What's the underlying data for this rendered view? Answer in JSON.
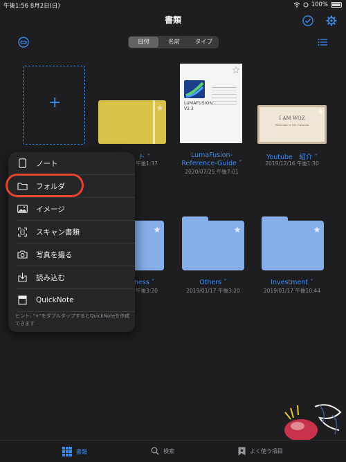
{
  "status": {
    "time": "午後1:56",
    "date": "8月2日(日)",
    "battery": "100%"
  },
  "header": {
    "title": "書類"
  },
  "sort": {
    "options": [
      "日付",
      "名前",
      "タイプ"
    ],
    "selected": "日付"
  },
  "documents": [
    {
      "label": "ノート",
      "date": "午後1:37"
    },
    {
      "label": "LumaFusion-Reference-Guide",
      "label_line1": "LumaFusion-",
      "label_line2": "Reference-Guide",
      "date": "2020/07/25 午後7:01",
      "cover_text_1": "LUMAFUSION",
      "cover_text_2": "V2.3"
    },
    {
      "label": "Youtube　紹介",
      "date": "2019/12/16 午後1:30",
      "cover_text_1": "I AM WOZ",
      "cover_text_2": "Welcome to Mr Caravan"
    }
  ],
  "folders": [
    {
      "label": "Business",
      "label_visible": "ness",
      "date": "午後3:20"
    },
    {
      "label": "Others",
      "date": "2019/01/17 午後3:20"
    },
    {
      "label": "Investment",
      "date": "2019/01/17 午後10:44"
    }
  ],
  "menu": {
    "items": [
      {
        "label": "ノート",
        "icon": "tablet-icon"
      },
      {
        "label": "フォルダ",
        "icon": "folder-icon"
      },
      {
        "label": "イメージ",
        "icon": "image-icon"
      },
      {
        "label": "スキャン書類",
        "icon": "scan-icon"
      },
      {
        "label": "写真を撮る",
        "icon": "camera-icon"
      },
      {
        "label": "読み込む",
        "icon": "import-icon"
      },
      {
        "label": "QuickNote",
        "icon": "quicknote-icon"
      }
    ],
    "hint": "ヒント: \"+\"をダブルタップするとQuickNoteを作成できます"
  },
  "tabbar": {
    "items": [
      {
        "label": "書類"
      },
      {
        "label": "検索"
      },
      {
        "label": "よく使う項目"
      }
    ]
  },
  "colors": {
    "accent": "#3d8cf0",
    "folder": "#86aee8",
    "highlight": "#e5452b",
    "notebook": "#d9c24a"
  }
}
